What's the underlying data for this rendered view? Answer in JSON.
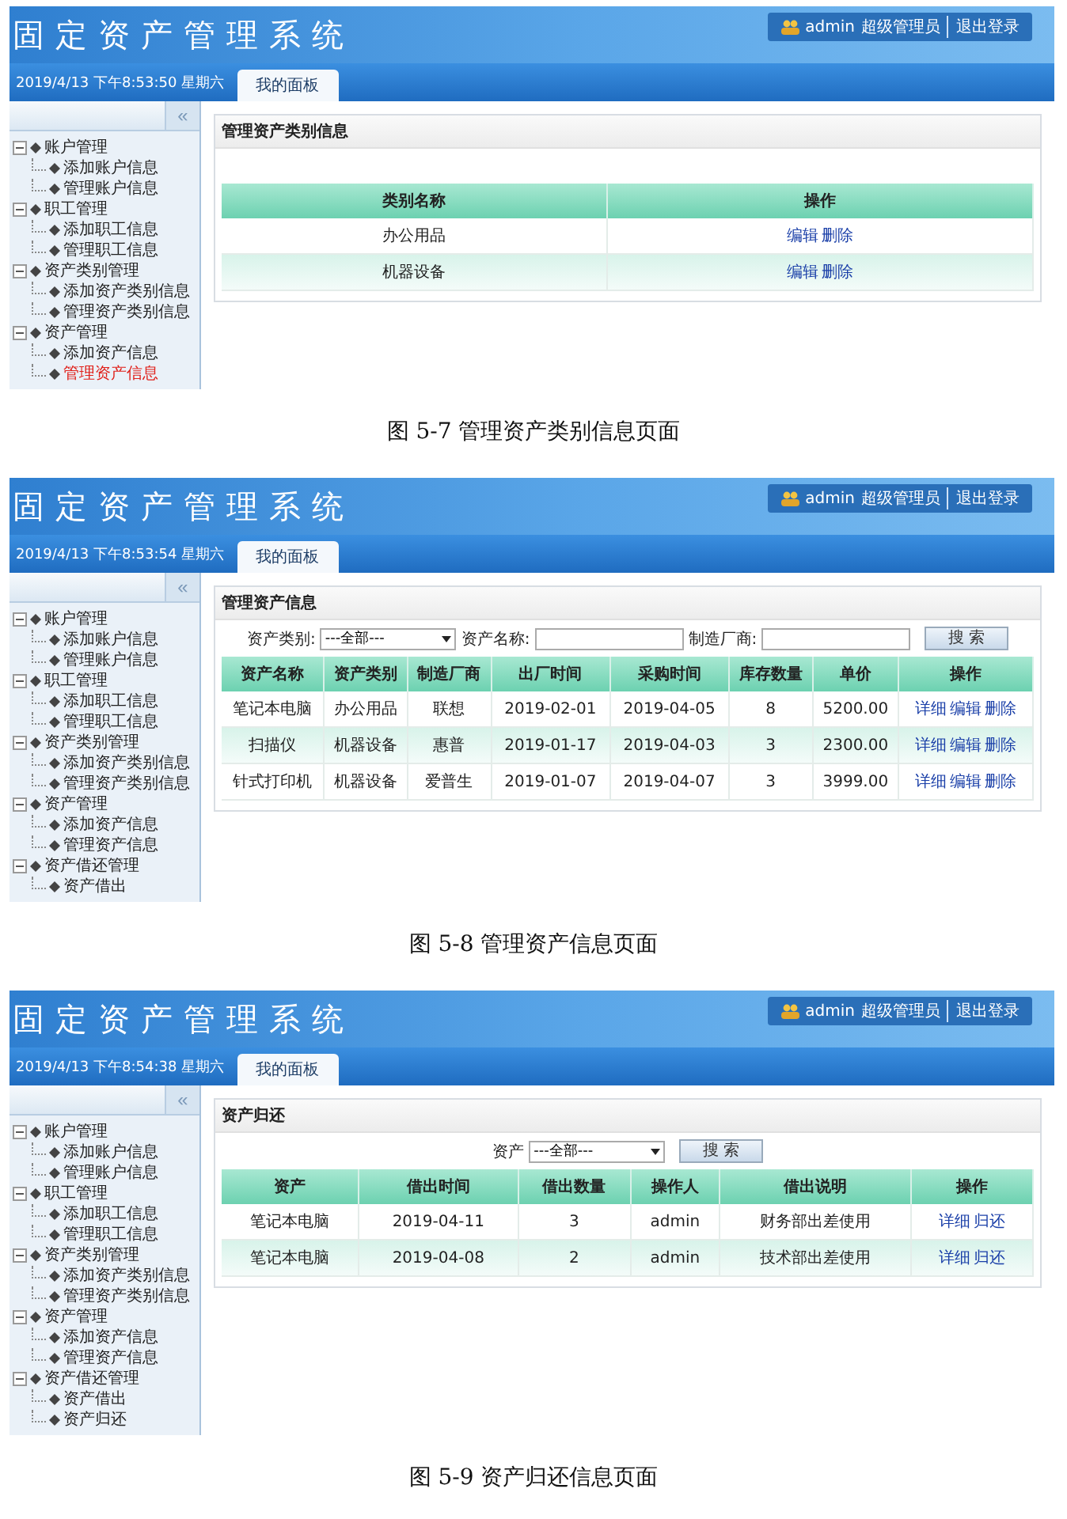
{
  "figures": [
    {
      "screen": {
        "title": "固定资产管理系统",
        "user": "admin",
        "role": "超级管理员",
        "logout": "退出登录",
        "datetime": "2019/4/13 下午8:53:50 星期六",
        "tab": "我的面板",
        "collapse": "«",
        "sidebar": [
          {
            "label": "账户管理",
            "expanded": true,
            "children": [
              {
                "label": "添加账户信息",
                "selected": false
              },
              {
                "label": "管理账户信息",
                "selected": false
              }
            ]
          },
          {
            "label": "职工管理",
            "expanded": true,
            "children": [
              {
                "label": "添加职工信息",
                "selected": false
              },
              {
                "label": "管理职工信息",
                "selected": false
              }
            ]
          },
          {
            "label": "资产类别管理",
            "expanded": true,
            "children": [
              {
                "label": "添加资产类别信息",
                "selected": false
              },
              {
                "label": "管理资产类别信息",
                "selected": false
              }
            ]
          },
          {
            "label": "资产管理",
            "expanded": true,
            "children": [
              {
                "label": "添加资产信息",
                "selected": false
              },
              {
                "label": "管理资产信息",
                "selected": true
              }
            ]
          }
        ],
        "panel_title": "管理资产类别信息",
        "table": {
          "columns": [
            "类别名称",
            "操作"
          ],
          "rows": [
            {
              "cells": [
                "办公用品"
              ],
              "actions": [
                "编辑",
                "删除"
              ]
            },
            {
              "cells": [
                "机器设备"
              ],
              "actions": [
                "编辑",
                "删除"
              ]
            }
          ]
        }
      },
      "caption": "图 5-7 管理资产类别信息页面"
    },
    {
      "screen": {
        "title": "固定资产管理系统",
        "user": "admin",
        "role": "超级管理员",
        "logout": "退出登录",
        "datetime": "2019/4/13 下午8:53:54 星期六",
        "tab": "我的面板",
        "collapse": "«",
        "sidebar": [
          {
            "label": "账户管理",
            "expanded": true,
            "children": [
              {
                "label": "添加账户信息",
                "selected": false
              },
              {
                "label": "管理账户信息",
                "selected": false
              }
            ]
          },
          {
            "label": "职工管理",
            "expanded": true,
            "children": [
              {
                "label": "添加职工信息",
                "selected": false
              },
              {
                "label": "管理职工信息",
                "selected": false
              }
            ]
          },
          {
            "label": "资产类别管理",
            "expanded": true,
            "children": [
              {
                "label": "添加资产类别信息",
                "selected": false
              },
              {
                "label": "管理资产类别信息",
                "selected": false
              }
            ]
          },
          {
            "label": "资产管理",
            "expanded": true,
            "children": [
              {
                "label": "添加资产信息",
                "selected": false
              },
              {
                "label": "管理资产信息",
                "selected": false
              }
            ]
          },
          {
            "label": "资产借还管理",
            "expanded": true,
            "children": [
              {
                "label": "资产借出",
                "selected": false
              }
            ]
          }
        ],
        "panel_title": "管理资产信息",
        "search": {
          "fields": [
            {
              "kind": "select",
              "label": "资产类别:",
              "value": "---全部---"
            },
            {
              "kind": "text",
              "label": "资产名称:"
            },
            {
              "kind": "text",
              "label": "制造厂商:"
            }
          ],
          "button": "搜 索"
        },
        "table": {
          "columns": [
            "资产名称",
            "资产类别",
            "制造厂商",
            "出厂时间",
            "采购时间",
            "库存数量",
            "单价",
            "操作"
          ],
          "rows": [
            {
              "cells": [
                "笔记本电脑",
                "办公用品",
                "联想",
                "2019-02-01",
                "2019-04-05",
                "8",
                "5200.00"
              ],
              "actions": [
                "详细",
                "编辑",
                "删除"
              ]
            },
            {
              "cells": [
                "扫描仪",
                "机器设备",
                "惠普",
                "2019-01-17",
                "2019-04-03",
                "3",
                "2300.00"
              ],
              "actions": [
                "详细",
                "编辑",
                "删除"
              ]
            },
            {
              "cells": [
                "针式打印机",
                "机器设备",
                "爱普生",
                "2019-01-07",
                "2019-04-07",
                "3",
                "3999.00"
              ],
              "actions": [
                "详细",
                "编辑",
                "删除"
              ]
            }
          ]
        }
      },
      "caption": "图 5-8 管理资产信息页面"
    },
    {
      "screen": {
        "title": "固定资产管理系统",
        "user": "admin",
        "role": "超级管理员",
        "logout": "退出登录",
        "datetime": "2019/4/13 下午8:54:38 星期六",
        "tab": "我的面板",
        "collapse": "«",
        "sidebar": [
          {
            "label": "账户管理",
            "expanded": true,
            "children": [
              {
                "label": "添加账户信息",
                "selected": false
              },
              {
                "label": "管理账户信息",
                "selected": false
              }
            ]
          },
          {
            "label": "职工管理",
            "expanded": true,
            "children": [
              {
                "label": "添加职工信息",
                "selected": false
              },
              {
                "label": "管理职工信息",
                "selected": false
              }
            ]
          },
          {
            "label": "资产类别管理",
            "expanded": true,
            "children": [
              {
                "label": "添加资产类别信息",
                "selected": false
              },
              {
                "label": "管理资产类别信息",
                "selected": false
              }
            ]
          },
          {
            "label": "资产管理",
            "expanded": true,
            "children": [
              {
                "label": "添加资产信息",
                "selected": false
              },
              {
                "label": "管理资产信息",
                "selected": false
              }
            ]
          },
          {
            "label": "资产借还管理",
            "expanded": true,
            "children": [
              {
                "label": "资产借出",
                "selected": false
              },
              {
                "label": "资产归还",
                "selected": false
              }
            ]
          }
        ],
        "panel_title": "资产归还",
        "search": {
          "fields": [
            {
              "kind": "select",
              "label": "资产",
              "value": "---全部---"
            }
          ],
          "button": "搜 索"
        },
        "table": {
          "columns": [
            "资产",
            "借出时间",
            "借出数量",
            "操作人",
            "借出说明",
            "操作"
          ],
          "rows": [
            {
              "cells": [
                "笔记本电脑",
                "2019-04-11",
                "3",
                "admin",
                "财务部出差使用"
              ],
              "actions": [
                "详细",
                "归还"
              ]
            },
            {
              "cells": [
                "笔记本电脑",
                "2019-04-08",
                "2",
                "admin",
                "技术部出差使用"
              ],
              "actions": [
                "详细",
                "归还"
              ]
            }
          ]
        }
      },
      "caption": "图 5-9 资产归还信息页面"
    }
  ]
}
